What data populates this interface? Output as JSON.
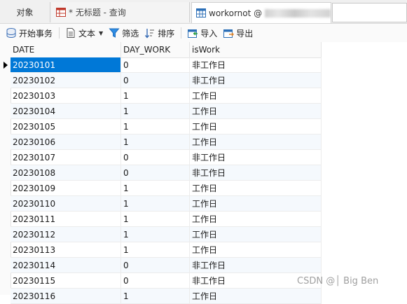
{
  "tabs": {
    "objects": "对象",
    "query": "* 无标题 - 查询",
    "table_name": "workornot @"
  },
  "toolbar": {
    "begin_transaction": "开始事务",
    "text": "文本",
    "filter": "筛选",
    "sort": "排序",
    "import": "导入",
    "export": "导出"
  },
  "grid": {
    "columns": [
      "DATE",
      "DAY_WORK",
      "isWork"
    ],
    "rows": [
      [
        "20230101",
        "0",
        "非工作日"
      ],
      [
        "20230102",
        "0",
        "非工作日"
      ],
      [
        "20230103",
        "1",
        "工作日"
      ],
      [
        "20230104",
        "1",
        "工作日"
      ],
      [
        "20230105",
        "1",
        "工作日"
      ],
      [
        "20230106",
        "1",
        "工作日"
      ],
      [
        "20230107",
        "0",
        "非工作日"
      ],
      [
        "20230108",
        "0",
        "非工作日"
      ],
      [
        "20230109",
        "1",
        "工作日"
      ],
      [
        "20230110",
        "1",
        "工作日"
      ],
      [
        "20230111",
        "1",
        "工作日"
      ],
      [
        "20230112",
        "1",
        "工作日"
      ],
      [
        "20230113",
        "1",
        "工作日"
      ],
      [
        "20230114",
        "0",
        "非工作日"
      ],
      [
        "20230115",
        "0",
        "非工作日"
      ],
      [
        "20230116",
        "1",
        "工作日"
      ]
    ]
  },
  "watermark": "CSDN @│ Big Ben",
  "colors": {
    "selection": "#0078d7",
    "alt_row": "#f5f9fd"
  }
}
